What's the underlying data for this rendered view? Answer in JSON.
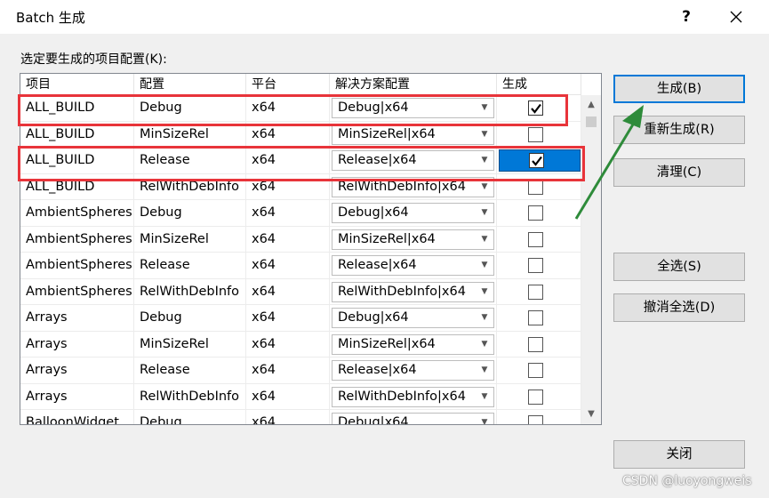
{
  "window": {
    "title": "Batch 生成",
    "help": "?"
  },
  "list_label": "选定要生成的项目配置(K):",
  "columns": [
    "项目",
    "配置",
    "平台",
    "解决方案配置",
    "生成"
  ],
  "rows": [
    {
      "project": "ALL_BUILD",
      "config": "Debug",
      "platform": "x64",
      "solution": "Debug|x64",
      "build": true
    },
    {
      "project": "ALL_BUILD",
      "config": "MinSizeRel",
      "platform": "x64",
      "solution": "MinSizeRel|x64",
      "build": false
    },
    {
      "project": "ALL_BUILD",
      "config": "Release",
      "platform": "x64",
      "solution": "Release|x64",
      "build": true
    },
    {
      "project": "ALL_BUILD",
      "config": "RelWithDebInfo",
      "platform": "x64",
      "solution": "RelWithDebInfo|x64",
      "build": false
    },
    {
      "project": "AmbientSpheres",
      "config": "Debug",
      "platform": "x64",
      "solution": "Debug|x64",
      "build": false
    },
    {
      "project": "AmbientSpheres",
      "config": "MinSizeRel",
      "platform": "x64",
      "solution": "MinSizeRel|x64",
      "build": false
    },
    {
      "project": "AmbientSpheres",
      "config": "Release",
      "platform": "x64",
      "solution": "Release|x64",
      "build": false
    },
    {
      "project": "AmbientSpheres",
      "config": "RelWithDebInfo",
      "platform": "x64",
      "solution": "RelWithDebInfo|x64",
      "build": false
    },
    {
      "project": "Arrays",
      "config": "Debug",
      "platform": "x64",
      "solution": "Debug|x64",
      "build": false
    },
    {
      "project": "Arrays",
      "config": "MinSizeRel",
      "platform": "x64",
      "solution": "MinSizeRel|x64",
      "build": false
    },
    {
      "project": "Arrays",
      "config": "Release",
      "platform": "x64",
      "solution": "Release|x64",
      "build": false
    },
    {
      "project": "Arrays",
      "config": "RelWithDebInfo",
      "platform": "x64",
      "solution": "RelWithDebInfo|x64",
      "build": false
    },
    {
      "project": "BalloonWidget",
      "config": "Debug",
      "platform": "x64",
      "solution": "Debug|x64",
      "build": false
    }
  ],
  "buttons": {
    "build": "生成(B)",
    "rebuild": "重新生成(R)",
    "clean": "清理(C)",
    "select_all": "全选(S)",
    "deselect_all": "撤消全选(D)",
    "close": "关闭"
  },
  "icons": {
    "close": "close-icon",
    "checkmark": "checkmark-icon",
    "dropdown": "chevron-down-icon",
    "scroll_up": "scroll-up-icon",
    "scroll_down": "scroll-down-icon"
  },
  "colors": {
    "highlight_red": "#e8343a",
    "arrow_green": "#2e8b3a",
    "selection_blue": "#0078d7"
  },
  "watermark": "CSDN @luoyongweis"
}
